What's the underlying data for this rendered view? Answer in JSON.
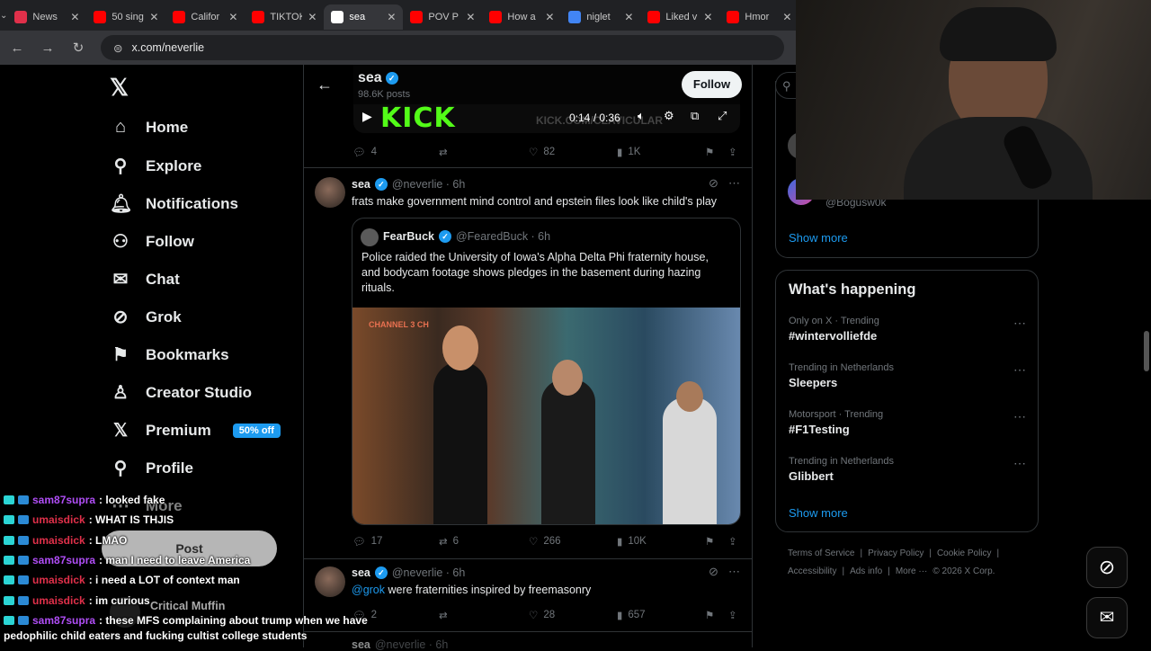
{
  "browser": {
    "tabs": [
      {
        "label": "News",
        "color": "#e0304a"
      },
      {
        "label": "50 sing",
        "color": "#ff0000"
      },
      {
        "label": "Califor",
        "color": "#ff0000"
      },
      {
        "label": "TIKTOK",
        "color": "#ff0000"
      },
      {
        "label": "sea",
        "color": "#ffffff",
        "active": true
      },
      {
        "label": "POV P",
        "color": "#ff0000"
      },
      {
        "label": "How a",
        "color": "#ff0000"
      },
      {
        "label": "niglet",
        "color": "#4285f4"
      },
      {
        "label": "Liked v",
        "color": "#ff0000"
      },
      {
        "label": "Hmor",
        "color": "#ff0000"
      }
    ],
    "url": "x.com/neverlie"
  },
  "sidebar": {
    "items": [
      {
        "label": "Home",
        "icon": "home-icon",
        "glyph": "⌂"
      },
      {
        "label": "Explore",
        "icon": "search-icon",
        "glyph": "⚲"
      },
      {
        "label": "Notifications",
        "icon": "bell-icon",
        "glyph": "🔔︎"
      },
      {
        "label": "Follow",
        "icon": "person-add-icon",
        "glyph": "⚇"
      },
      {
        "label": "Chat",
        "icon": "mail-icon",
        "glyph": "✉"
      },
      {
        "label": "Grok",
        "icon": "grok-icon",
        "glyph": "⊘"
      },
      {
        "label": "Bookmarks",
        "icon": "bookmark-icon",
        "glyph": "⚑"
      },
      {
        "label": "Creator Studio",
        "icon": "studio-icon",
        "glyph": "♙"
      },
      {
        "label": "Premium",
        "icon": "x-logo-icon",
        "glyph": "𝕏"
      },
      {
        "label": "Profile",
        "icon": "person-icon",
        "glyph": "⚲"
      },
      {
        "label": "More",
        "icon": "more-icon",
        "glyph": "⋯"
      }
    ],
    "premium_badge": "50% off",
    "post_button": "Post",
    "account_name": "Critical Muffin"
  },
  "header": {
    "name": "sea",
    "posts": "98.6K posts",
    "follow": "Follow"
  },
  "video": {
    "time": "0:14 / 0:36",
    "banner": "KICK",
    "watermark": "KICK.COM/CLAVICULAR"
  },
  "post0": {
    "replies": "4",
    "likes": "82",
    "views": "1K"
  },
  "post1": {
    "name": "sea",
    "handle": "@neverlie · 6h",
    "text": "frats make government mind control and epstein files look like child's play",
    "quote": {
      "name": "FearBuck",
      "handle": "@FearedBuck · 6h",
      "text": "Police raided the University of Iowa's Alpha Delta Phi fraternity house, and bodycam footage shows pledges in the basement during hazing rituals.",
      "image_caption": "CHANNEL 3 CH"
    },
    "replies": "17",
    "reposts": "6",
    "likes": "266",
    "views": "10K"
  },
  "post2": {
    "name": "sea",
    "handle": "@neverlie · 6h",
    "mention": "@grok",
    "text": " were fraternities inspired by freemasonry",
    "replies": "2",
    "likes": "28",
    "views": "657"
  },
  "post3": {
    "name": "sea",
    "handle": "@neverlie · 6h"
  },
  "right": {
    "who_handle": "@Bogusw0k",
    "show_more": "Show more",
    "happening_title": "What's happening",
    "trends": [
      {
        "category": "Only on X · Trending",
        "name": "#wintervolliefde"
      },
      {
        "category": "Trending in Netherlands",
        "name": "Sleepers"
      },
      {
        "category": "Motorsport · Trending",
        "name": "#F1Testing"
      },
      {
        "category": "Trending in Netherlands",
        "name": "Glibbert"
      }
    ],
    "show_more_2": "Show more",
    "footer": [
      "Terms of Service",
      "|",
      "Privacy Policy",
      "|",
      "Cookie Policy",
      "|",
      "Accessibility",
      "|",
      "Ads info",
      "|",
      "More ···",
      "© 2026 X Corp."
    ]
  },
  "chat": [
    {
      "user": "sam87supra",
      "color": "u1",
      "msg": ": looked fake"
    },
    {
      "user": "umaisdick",
      "color": "u2",
      "msg": ": WHAT IS THJIS"
    },
    {
      "user": "umaisdick",
      "color": "u2",
      "msg": ": LMAO"
    },
    {
      "user": "sam87supra",
      "color": "u1",
      "msg": ": man I need to leave America"
    },
    {
      "user": "umaisdick",
      "color": "u2",
      "msg": ": i need a LOT of context man"
    },
    {
      "user": "umaisdick",
      "color": "u2",
      "msg": ": im curious"
    },
    {
      "user": "sam87supra",
      "color": "u1",
      "msg": ": these MFS complaining about trump when we have"
    }
  ],
  "chat_wrap": "pedophilic child eaters and fucking cultist college students"
}
